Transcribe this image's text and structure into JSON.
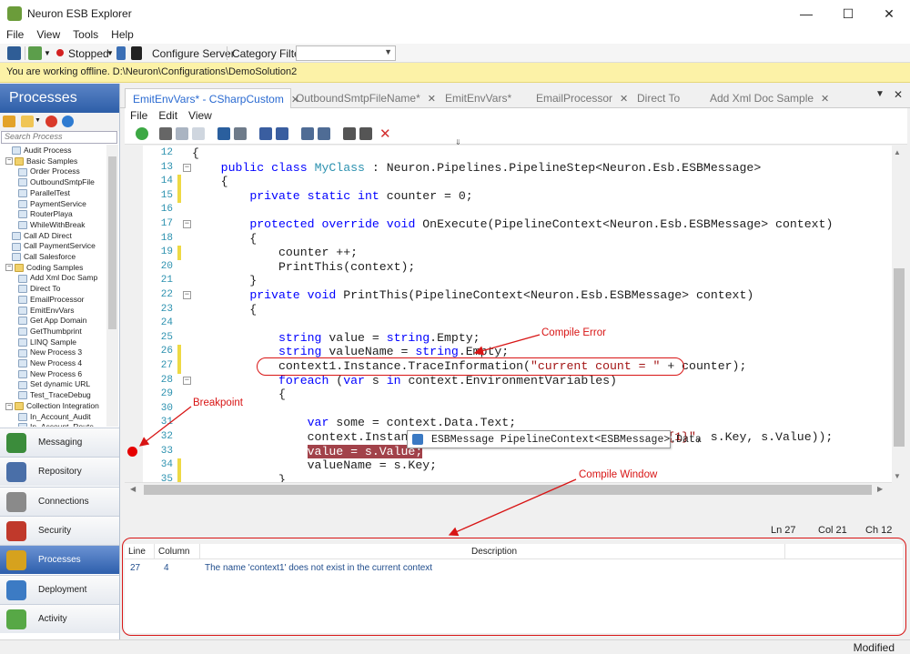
{
  "window": {
    "title": "Neuron ESB Explorer"
  },
  "menu": [
    "File",
    "View",
    "Tools",
    "Help"
  ],
  "toolbar": {
    "status": "Stopped",
    "configure": "Configure Server",
    "category_filter": "Category Filter",
    "category_value": ""
  },
  "offline_message": "You are working offline. D:\\Neuron\\Configurations\\DemoSolution2",
  "left": {
    "title": "Processes",
    "search_placeholder": "Search Process",
    "tree": [
      {
        "label": "Audit Process",
        "level": 1,
        "type": "proc"
      },
      {
        "label": "Basic Samples",
        "level": 0,
        "type": "folder"
      },
      {
        "label": "Order Process",
        "level": 2,
        "type": "proc"
      },
      {
        "label": "OutboundSmtpFile",
        "level": 2,
        "type": "proc"
      },
      {
        "label": "ParallelTest",
        "level": 2,
        "type": "proc"
      },
      {
        "label": "PaymentService",
        "level": 2,
        "type": "proc"
      },
      {
        "label": "RouterPlaya",
        "level": 2,
        "type": "proc"
      },
      {
        "label": "WhileWithBreak",
        "level": 2,
        "type": "proc"
      },
      {
        "label": "Call AD Direct",
        "level": 1,
        "type": "proc"
      },
      {
        "label": "Call PaymentService",
        "level": 1,
        "type": "proc"
      },
      {
        "label": "Call Salesforce",
        "level": 1,
        "type": "proc"
      },
      {
        "label": "Coding Samples",
        "level": 0,
        "type": "folder"
      },
      {
        "label": "Add Xml Doc Samp",
        "level": 2,
        "type": "proc"
      },
      {
        "label": "Direct To",
        "level": 2,
        "type": "proc"
      },
      {
        "label": "EmailProcessor",
        "level": 2,
        "type": "proc"
      },
      {
        "label": "EmitEnvVars",
        "level": 2,
        "type": "proc"
      },
      {
        "label": "Get App Domain",
        "level": 2,
        "type": "proc"
      },
      {
        "label": "GetThumbprint",
        "level": 2,
        "type": "proc"
      },
      {
        "label": "LINQ Sample",
        "level": 2,
        "type": "proc"
      },
      {
        "label": "New Process 3",
        "level": 2,
        "type": "proc"
      },
      {
        "label": "New Process 4",
        "level": 2,
        "type": "proc"
      },
      {
        "label": "New Process 6",
        "level": 2,
        "type": "proc"
      },
      {
        "label": "Set dynamic URL",
        "level": 2,
        "type": "proc"
      },
      {
        "label": "Test_TraceDebug",
        "level": 2,
        "type": "proc"
      },
      {
        "label": "Collection Integration",
        "level": 0,
        "type": "folder"
      },
      {
        "label": "In_Account_Audit",
        "level": 2,
        "type": "proc"
      },
      {
        "label": "In_Account_Route",
        "level": 2,
        "type": "proc"
      }
    ],
    "nav": [
      {
        "label": "Messaging",
        "color": "#3b8c3b"
      },
      {
        "label": "Repository",
        "color": "#4a6fa8"
      },
      {
        "label": "Connections",
        "color": "#8a8a8a"
      },
      {
        "label": "Security",
        "color": "#c0392b"
      },
      {
        "label": "Processes",
        "color": "#d6a21e",
        "active": true
      },
      {
        "label": "Deployment",
        "color": "#3c7bc4"
      },
      {
        "label": "Activity",
        "color": "#57a846"
      }
    ]
  },
  "tabs": [
    {
      "label": "EmitEnvVars* - CSharpCustom",
      "active": true
    },
    {
      "label": "OutboundSmtpFileName*"
    },
    {
      "label": "EmitEnvVars*"
    },
    {
      "label": "EmailProcessor"
    },
    {
      "label": "Direct To"
    },
    {
      "label": "Add Xml Doc Sample"
    }
  ],
  "editor_menu": [
    "File",
    "Edit",
    "View"
  ],
  "code": [
    {
      "n": 12,
      "html": "{"
    },
    {
      "n": 13,
      "fold": true,
      "html": "    <span class='kw'>public</span> <span class='kw'>class</span> <span class='tp'>MyClass</span> : Neuron.Pipelines.PipelineStep&lt;Neuron.Esb.ESBMessage&gt;"
    },
    {
      "n": 14,
      "mod": true,
      "html": "    {"
    },
    {
      "n": 15,
      "mod": true,
      "html": "        <span class='kw'>private</span> <span class='kw'>static</span> <span class='kw'>int</span> counter = 0;"
    },
    {
      "n": 16,
      "html": ""
    },
    {
      "n": 17,
      "fold": true,
      "html": "        <span class='kw'>protected</span> <span class='kw'>override</span> <span class='kw'>void</span> OnExecute(PipelineContext&lt;Neuron.Esb.ESBMessage&gt; context)"
    },
    {
      "n": 18,
      "html": "        {"
    },
    {
      "n": 19,
      "mod": true,
      "html": "            counter ++;"
    },
    {
      "n": 20,
      "html": "            PrintThis(context);"
    },
    {
      "n": 21,
      "html": "        }"
    },
    {
      "n": 22,
      "fold": true,
      "html": "        <span class='kw'>private</span> <span class='kw'>void</span> PrintThis(PipelineContext&lt;Neuron.Esb.ESBMessage&gt; context)"
    },
    {
      "n": 23,
      "html": "        {"
    },
    {
      "n": 24,
      "html": ""
    },
    {
      "n": 25,
      "html": "            <span class='kw'>string</span> value = <span class='kw'>string</span>.Empty;"
    },
    {
      "n": 26,
      "mod": true,
      "html": "            <span class='kw'>string</span> valueName = <span class='kw'>string</span>.Empty;"
    },
    {
      "n": 27,
      "mod": true,
      "html": "            context1.Instance.TraceInformation(<span class='str'>\"current count = \"</span> + counter);"
    },
    {
      "n": 28,
      "fold": true,
      "html": "            <span class='kw'>foreach</span> (<span class='kw'>var</span> s <span class='kw'>in</span> context.EnvironmentVariables)"
    },
    {
      "n": 29,
      "html": "            {"
    },
    {
      "n": 30,
      "html": ""
    },
    {
      "n": 31,
      "html": "                <span class='kw'>var</span> some = context.Data.Text;"
    },
    {
      "n": 32,
      "html": "                context.Instance.Tr                              <span class='str'>={1}\"</span>, s.Key, s.Value));"
    },
    {
      "n": 33,
      "html": "                <span class='hl-err'>value = s.Value;</span>"
    },
    {
      "n": 34,
      "mod": true,
      "html": "                valueName = s.Key;"
    },
    {
      "n": 35,
      "mod": true,
      "html": "            }"
    }
  ],
  "tooltip": "ESBMessage PipelineContext<ESBMessage>.Data",
  "annotations": {
    "compile_error": "Compile Error",
    "breakpoint": "Breakpoint",
    "compile_window": "Compile Window"
  },
  "position": {
    "ln": "Ln 27",
    "col": "Col 21",
    "ch": "Ch 12"
  },
  "errors": {
    "headers": [
      "Line",
      "Column",
      "Description"
    ],
    "rows": [
      {
        "line": "27",
        "column": "4",
        "description": "The name 'context1' does not exist in the current context"
      }
    ]
  },
  "status": "Modified"
}
